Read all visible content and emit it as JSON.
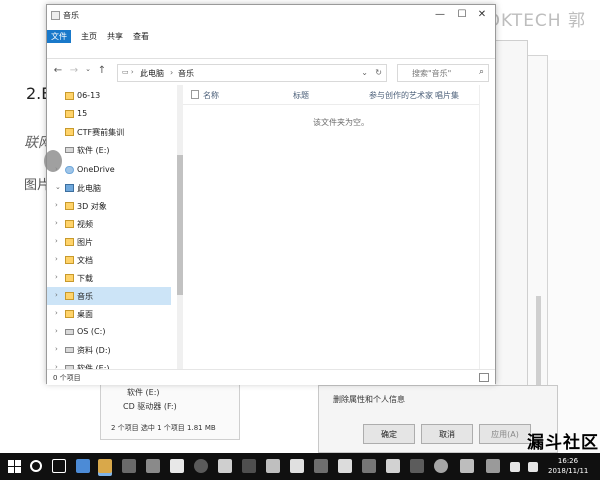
{
  "background": {
    "heading": "2.Ex",
    "sub1": "联网",
    "sub2": "图片",
    "right_text": "互",
    "brand": "GOKTECH 郭"
  },
  "window": {
    "title": "音乐",
    "tabs": [
      "文件",
      "主页",
      "共享",
      "查看"
    ],
    "active_tab": "文件",
    "controls": {
      "minimize": "—",
      "maximize": "☐",
      "close": "✕"
    },
    "address": {
      "crumbs": [
        "此电脑",
        "音乐"
      ]
    },
    "search_placeholder": "搜索\"音乐\"",
    "nav": [
      {
        "label": "06-13",
        "icon": "folder-icon",
        "arrow": ""
      },
      {
        "label": "15",
        "icon": "folder-icon",
        "arrow": ""
      },
      {
        "label": "CTF赛前集训",
        "icon": "folder-icon",
        "arrow": ""
      },
      {
        "label": "软件 (E:)",
        "icon": "drive-icon",
        "arrow": ""
      },
      {
        "label": "OneDrive",
        "icon": "cloud-icon",
        "arrow": "›"
      },
      {
        "label": "此电脑",
        "icon": "pc-icon",
        "arrow": "⌄"
      },
      {
        "label": "3D 对象",
        "icon": "folder-icon",
        "arrow": "›"
      },
      {
        "label": "视频",
        "icon": "folder-icon",
        "arrow": "›"
      },
      {
        "label": "图片",
        "icon": "folder-icon",
        "arrow": "›"
      },
      {
        "label": "文档",
        "icon": "folder-icon",
        "arrow": "›"
      },
      {
        "label": "下载",
        "icon": "folder-icon",
        "arrow": "›"
      },
      {
        "label": "音乐",
        "icon": "folder-icon",
        "arrow": "›",
        "selected": true
      },
      {
        "label": "桌面",
        "icon": "folder-icon",
        "arrow": "›"
      },
      {
        "label": "OS (C:)",
        "icon": "drive-icon",
        "arrow": "›"
      },
      {
        "label": "资料 (D:)",
        "icon": "drive-icon",
        "arrow": "›"
      },
      {
        "label": "软件 (E:)",
        "icon": "drive-icon",
        "arrow": "›"
      },
      {
        "label": "CD 驱动器 (F:)",
        "icon": "drive-icon",
        "arrow": "›"
      }
    ],
    "columns": [
      "名称",
      "标题",
      "参与创作的艺术家",
      "唱片集"
    ],
    "empty_message": "该文件夹为空。",
    "status": "0 个项目"
  },
  "dialog": {
    "text": "删除属性和个人信息",
    "ok": "确定",
    "cancel": "取消",
    "apply": "应用(A)"
  },
  "under_window": {
    "row1": "软件 (E:)",
    "row2": "CD 驱动器 (F:)",
    "status": "2 个项目    选中 1 个项目  1.81 MB"
  },
  "taskbar": {
    "time": "16:26",
    "date": "2018/11/11"
  },
  "watermark": "漏斗社区"
}
